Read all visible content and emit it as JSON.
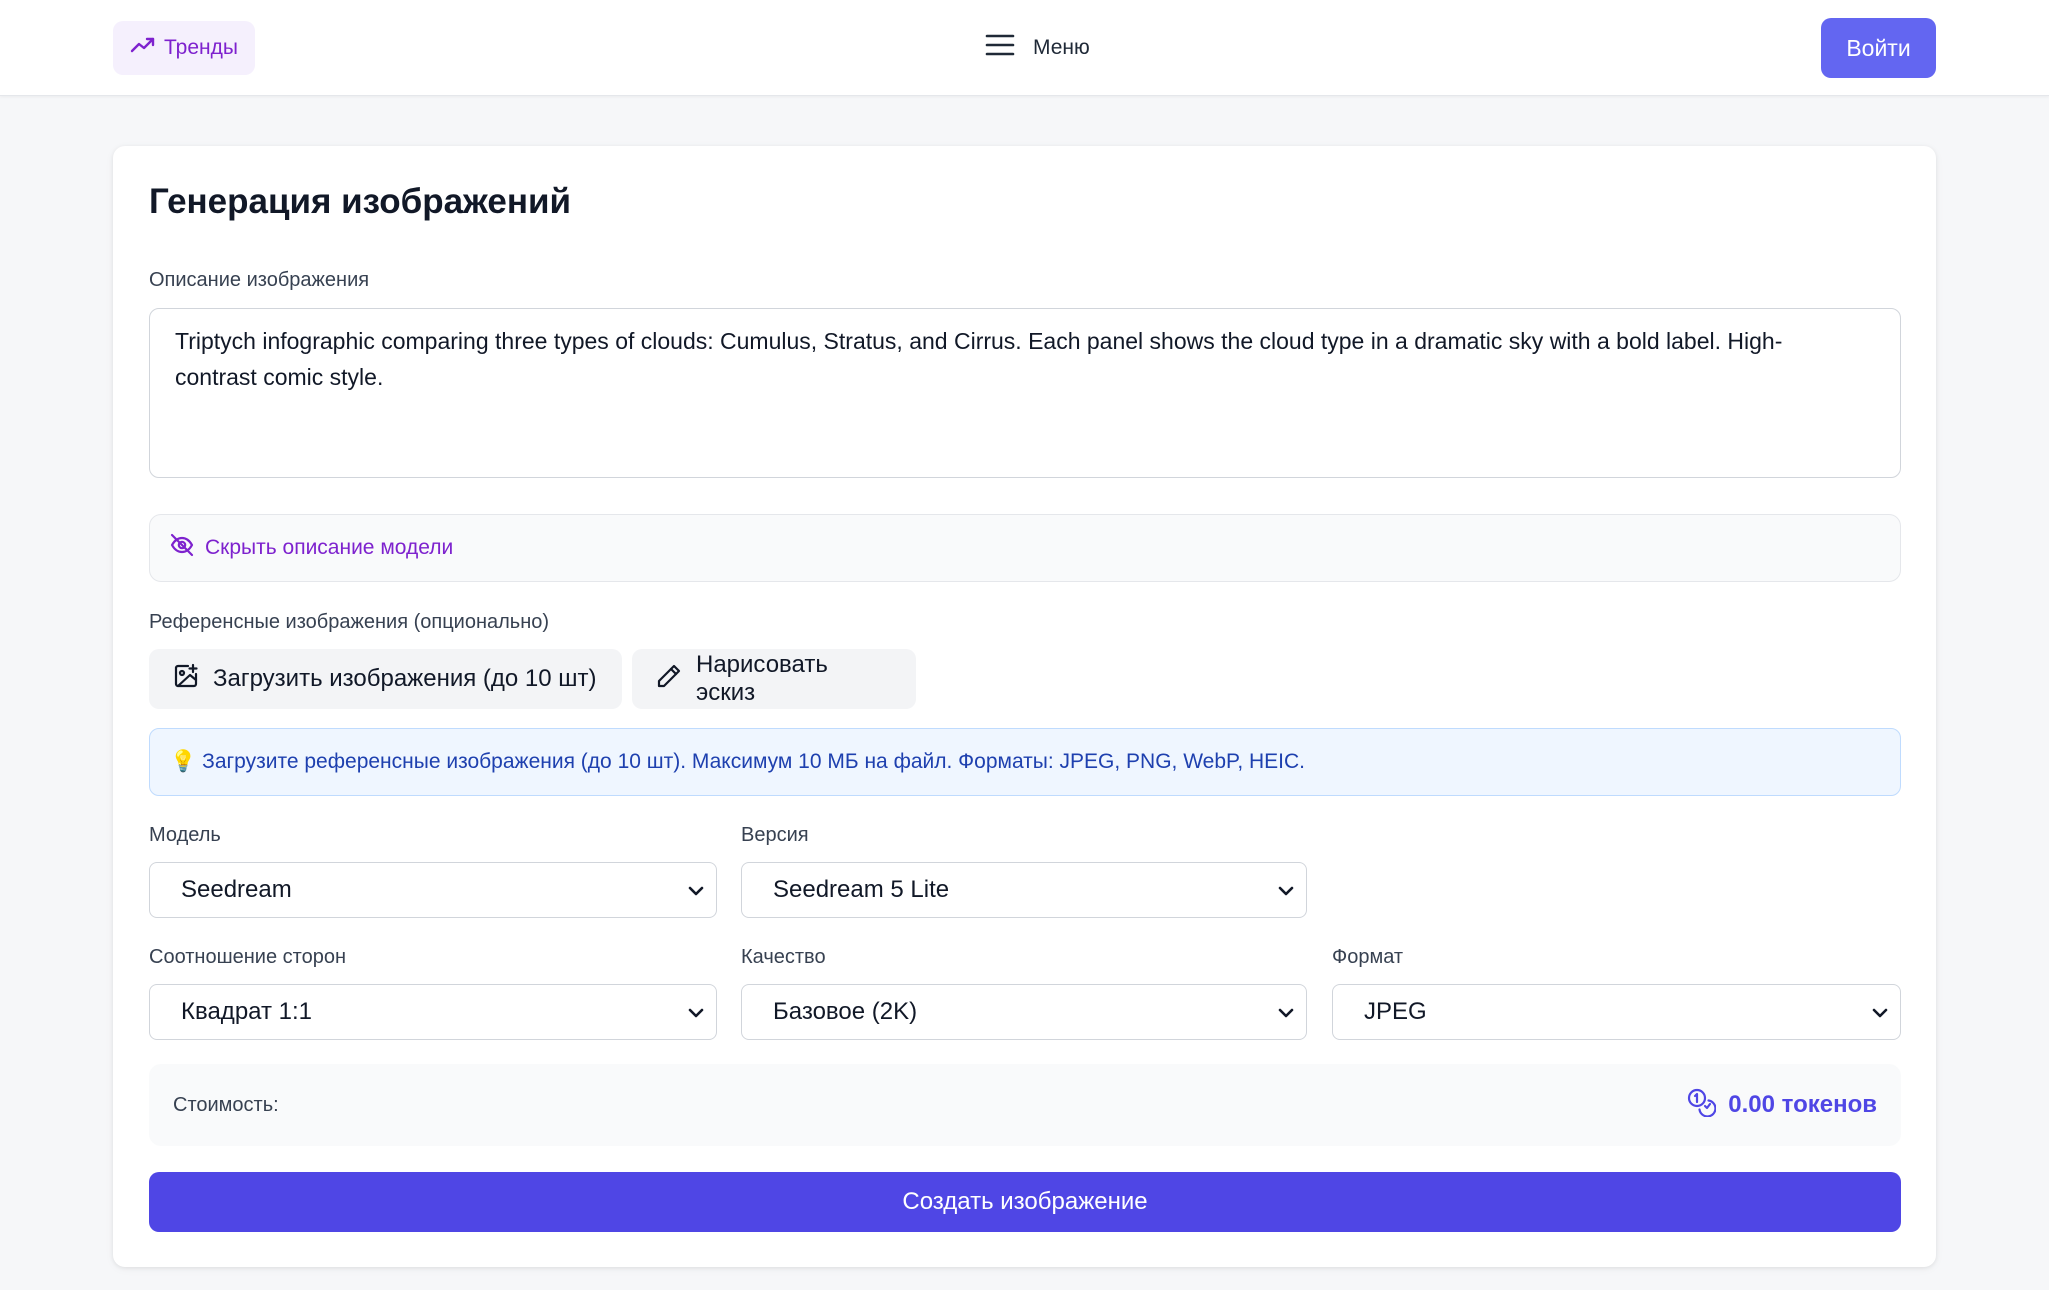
{
  "header": {
    "trends_label": "Тренды",
    "menu_label": "Меню",
    "login_label": "Войти"
  },
  "main": {
    "title": "Генерация изображений",
    "description_label": "Описание изображения",
    "description_value": "Triptych infographic comparing three types of clouds: Cumulus, Stratus, and Cirrus. Each panel shows the cloud type in a dramatic sky with a bold label. High-contrast comic style.",
    "hide_description_label": "Скрыть описание модели",
    "references_label": "Референсные изображения (опционально)",
    "upload_button_label": "Загрузить изображения (до 10 шт)",
    "sketch_button_label": "Нарисовать эскиз",
    "info_icon": "💡",
    "info_text": "Загрузите референсные изображения (до 10 шт). Максимум 10 МБ на файл. Форматы: JPEG, PNG, WebP, HEIC.",
    "model_label": "Модель",
    "model_value": "Seedream",
    "version_label": "Версия",
    "version_value": "Seedream 5 Lite",
    "aspect_label": "Соотношение сторон",
    "aspect_value": "Квадрат 1:1",
    "quality_label": "Качество",
    "quality_value": "Базовое (2K)",
    "format_label": "Формат",
    "format_value": "JPEG",
    "cost_label": "Стоимость:",
    "cost_value": "0.00 токенов",
    "submit_label": "Создать изображение"
  },
  "icons": {
    "trends": "trending-up-icon",
    "menu": "hamburger-icon",
    "hide": "eye-off-icon",
    "upload": "image-plus-icon",
    "sketch": "pencil-icon",
    "cost": "coins-icon",
    "select": "chevron-down-icon"
  },
  "colors": {
    "accent": "#4f46e5",
    "login": "#6366f1",
    "trends_text": "#7e22ce",
    "info_bg": "#eff6ff",
    "info_text": "#1e40af"
  }
}
